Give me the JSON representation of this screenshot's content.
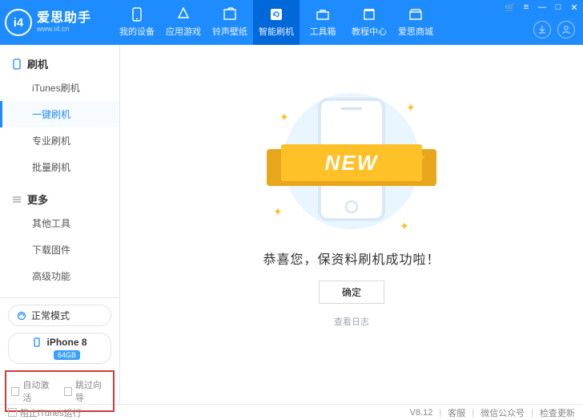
{
  "app": {
    "name": "爱思助手",
    "url": "www.i4.cn",
    "logo_glyph": "i4"
  },
  "win": {
    "cart": "🛒",
    "menu": "≡",
    "min": "—",
    "max": "□",
    "close": "✕"
  },
  "header_circles": {
    "download": "download",
    "user": "user"
  },
  "topnav": [
    {
      "label": "我的设备",
      "icon": "phone"
    },
    {
      "label": "应用游戏",
      "icon": "apps"
    },
    {
      "label": "铃声壁纸",
      "icon": "music"
    },
    {
      "label": "智能刷机",
      "icon": "refresh",
      "active": true
    },
    {
      "label": "工具箱",
      "icon": "toolbox"
    },
    {
      "label": "教程中心",
      "icon": "book"
    },
    {
      "label": "爱思商城",
      "icon": "store"
    }
  ],
  "sidebar": {
    "groups": [
      {
        "title": "刷机",
        "icon": "phone",
        "items": [
          {
            "label": "iTunes刷机"
          },
          {
            "label": "一键刷机",
            "active": true
          },
          {
            "label": "专业刷机"
          },
          {
            "label": "批量刷机"
          }
        ]
      },
      {
        "title": "更多",
        "icon": "more",
        "items": [
          {
            "label": "其他工具"
          },
          {
            "label": "下载固件"
          },
          {
            "label": "高级功能"
          }
        ]
      }
    ],
    "mode": {
      "label": "正常模式"
    },
    "device": {
      "name": "iPhone 8",
      "storage": "64GB"
    },
    "checks": {
      "auto_activate": "自动激活",
      "skip_guide": "跳过向导"
    }
  },
  "main": {
    "ribbon": "NEW",
    "success_text": "恭喜您，保资料刷机成功啦！",
    "ok_button": "确定",
    "log_link": "查看日志"
  },
  "foot": {
    "block_itunes": "阻止iTunes运行",
    "version": "V8.12",
    "support": "客服",
    "wechat": "微信公众号",
    "update": "检查更新"
  }
}
